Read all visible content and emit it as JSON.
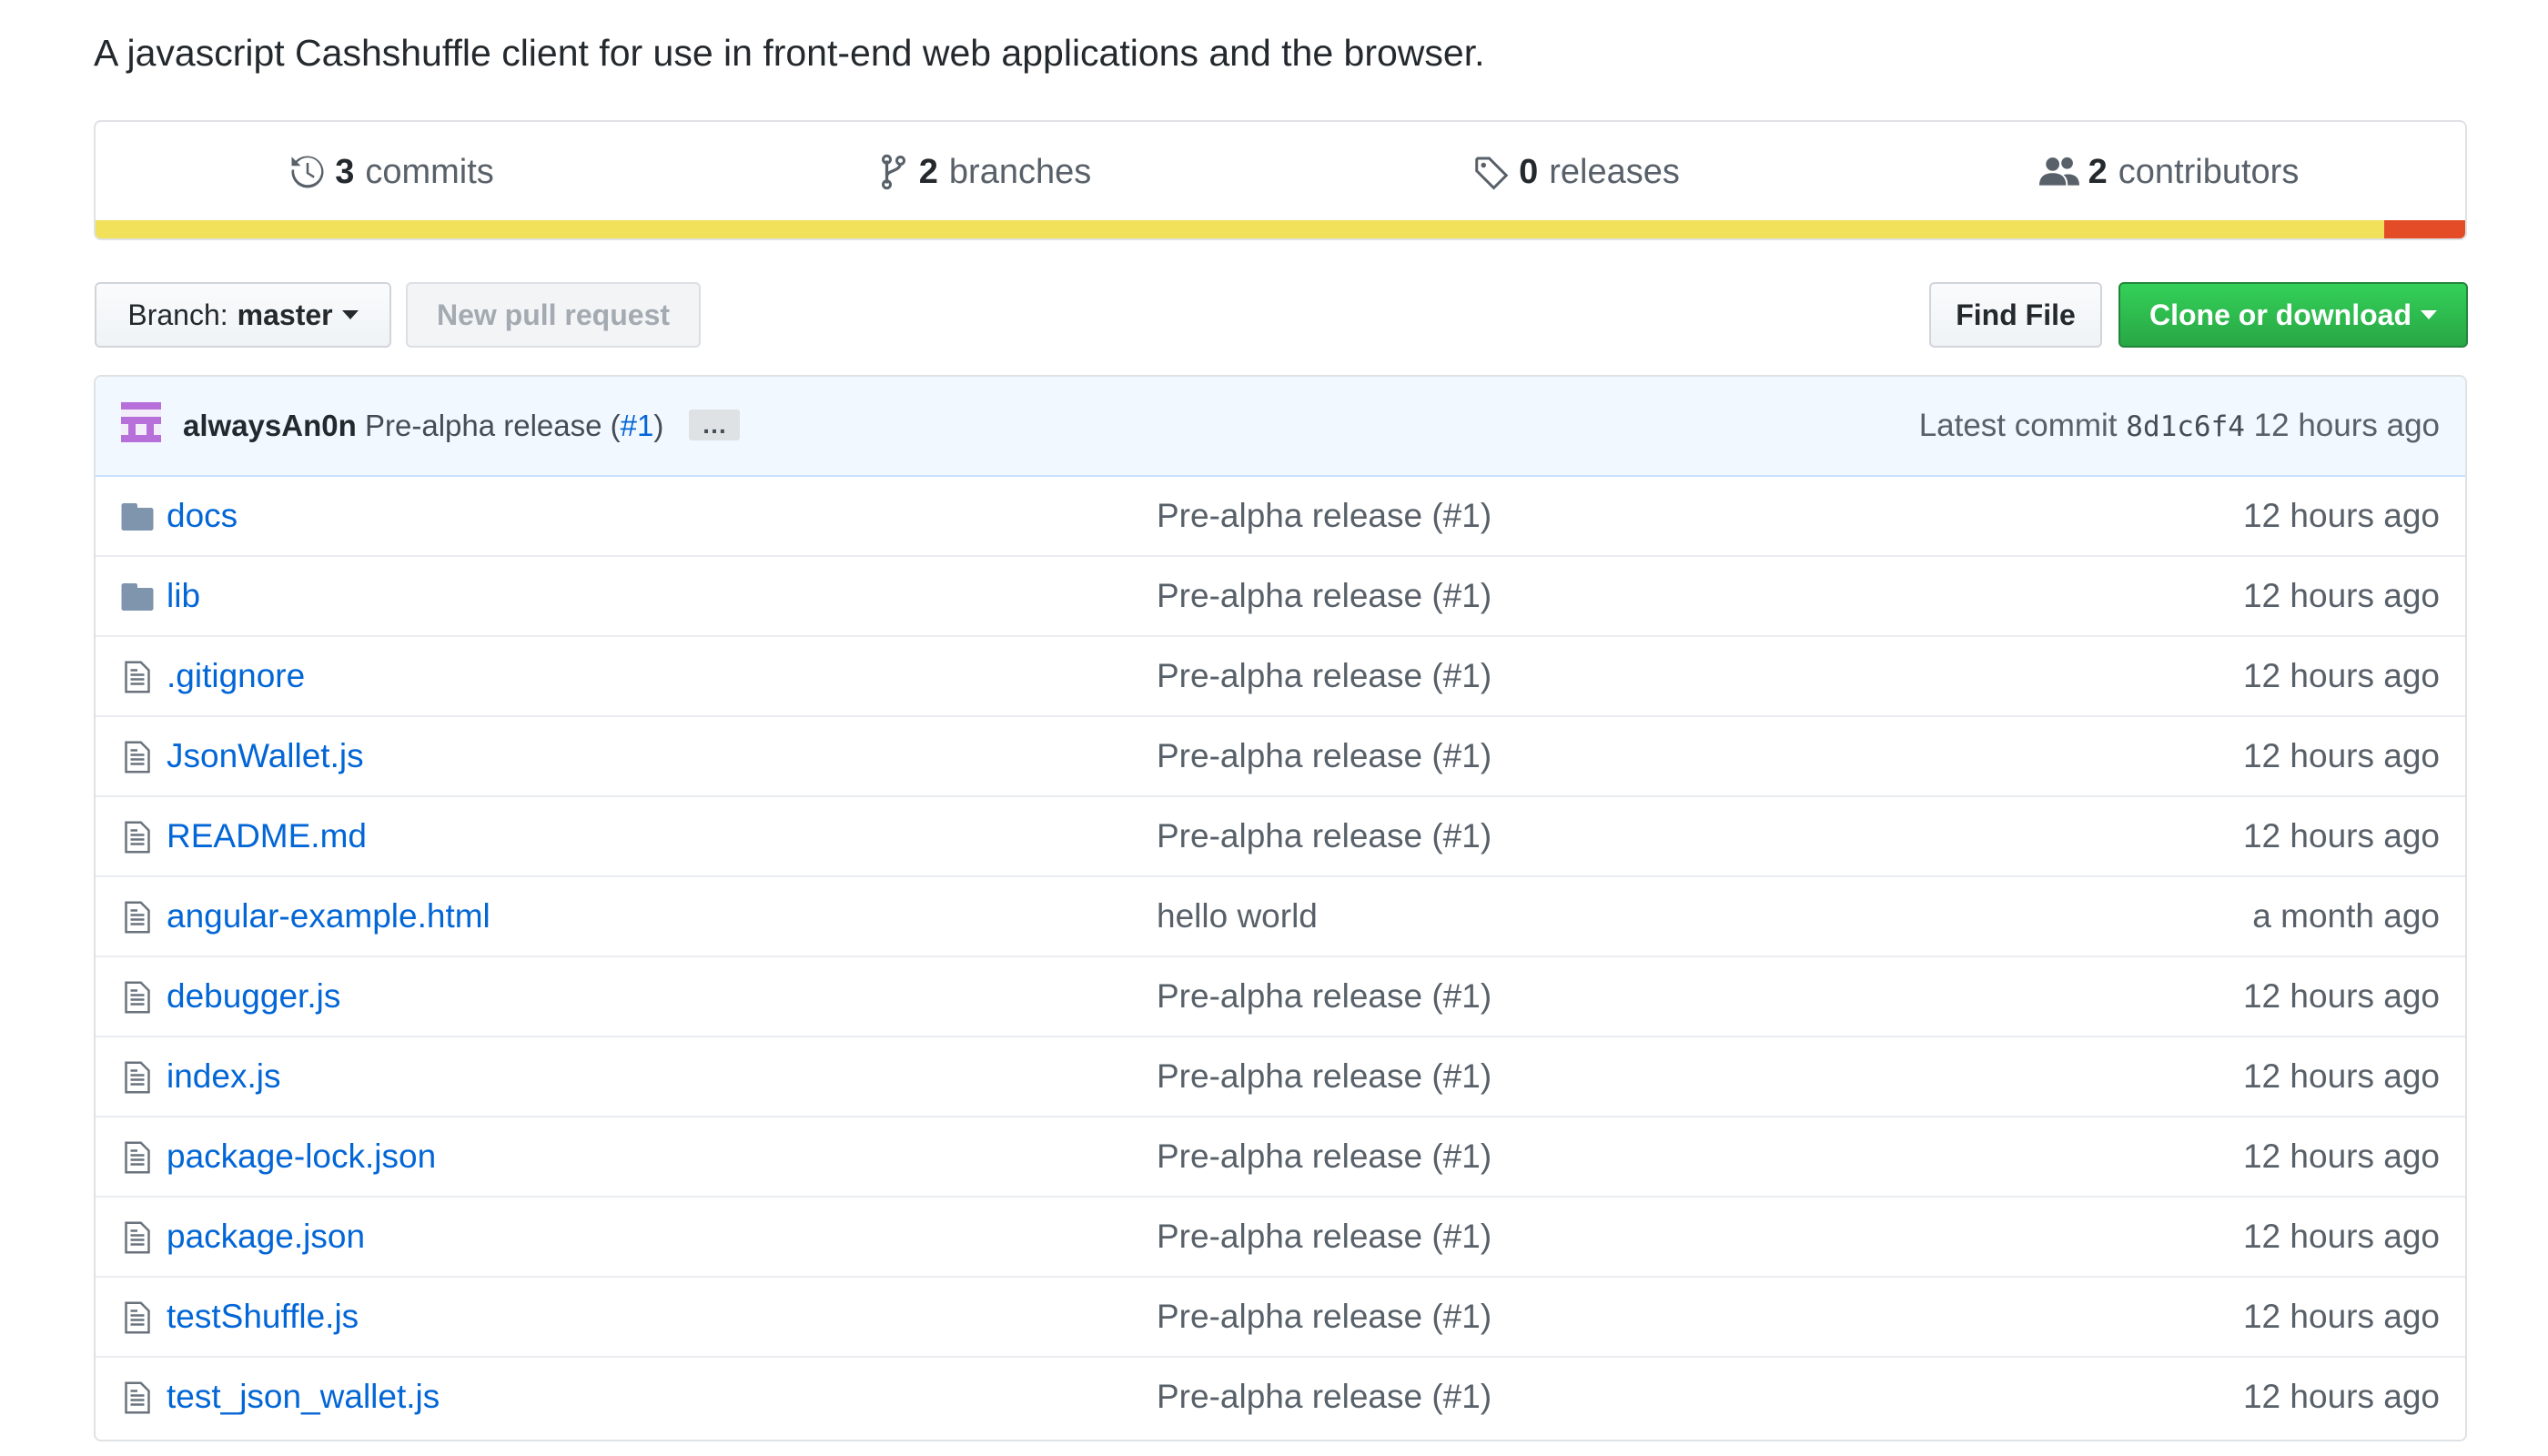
{
  "description": "A javascript Cashshuffle client for use in front-end web applications and the browser.",
  "stats": {
    "commits": {
      "count": "3",
      "label": "commits",
      "icon": "history-icon"
    },
    "branches": {
      "count": "2",
      "label": "branches",
      "icon": "git-branch-icon"
    },
    "releases": {
      "count": "0",
      "label": "releases",
      "icon": "tag-icon"
    },
    "contributors": {
      "count": "2",
      "label": "contributors",
      "icon": "people-icon"
    }
  },
  "language_bar": {
    "segments": [
      {
        "color": "#f1e05a",
        "share": 0.966
      },
      {
        "color": "#e34c26",
        "share": 0.034
      }
    ]
  },
  "toolbar": {
    "branch_label": "Branch:",
    "branch_value": "master",
    "new_pr_label": "New pull request",
    "find_file_label": "Find File",
    "clone_label": "Clone or download"
  },
  "latest_commit": {
    "author": "alwaysAn0n",
    "message": "Pre-alpha release",
    "issue_open": "(",
    "issue": "#1",
    "issue_close": ")",
    "ellipsis": "…",
    "prefix": "Latest commit",
    "sha": "8d1c6f4",
    "age": "12 hours ago"
  },
  "files": [
    {
      "type": "folder",
      "name": "docs",
      "message": "Pre-alpha release (#1)",
      "age": "12 hours ago"
    },
    {
      "type": "folder",
      "name": "lib",
      "message": "Pre-alpha release (#1)",
      "age": "12 hours ago"
    },
    {
      "type": "file",
      "name": ".gitignore",
      "message": "Pre-alpha release (#1)",
      "age": "12 hours ago"
    },
    {
      "type": "file",
      "name": "JsonWallet.js",
      "message": "Pre-alpha release (#1)",
      "age": "12 hours ago"
    },
    {
      "type": "file",
      "name": "README.md",
      "message": "Pre-alpha release (#1)",
      "age": "12 hours ago"
    },
    {
      "type": "file",
      "name": "angular-example.html",
      "message": "hello world",
      "age": "a month ago"
    },
    {
      "type": "file",
      "name": "debugger.js",
      "message": "Pre-alpha release (#1)",
      "age": "12 hours ago"
    },
    {
      "type": "file",
      "name": "index.js",
      "message": "Pre-alpha release (#1)",
      "age": "12 hours ago"
    },
    {
      "type": "file",
      "name": "package-lock.json",
      "message": "Pre-alpha release (#1)",
      "age": "12 hours ago"
    },
    {
      "type": "file",
      "name": "package.json",
      "message": "Pre-alpha release (#1)",
      "age": "12 hours ago"
    },
    {
      "type": "file",
      "name": "testShuffle.js",
      "message": "Pre-alpha release (#1)",
      "age": "12 hours ago"
    },
    {
      "type": "file",
      "name": "test_json_wallet.js",
      "message": "Pre-alpha release (#1)",
      "age": "12 hours ago"
    }
  ]
}
